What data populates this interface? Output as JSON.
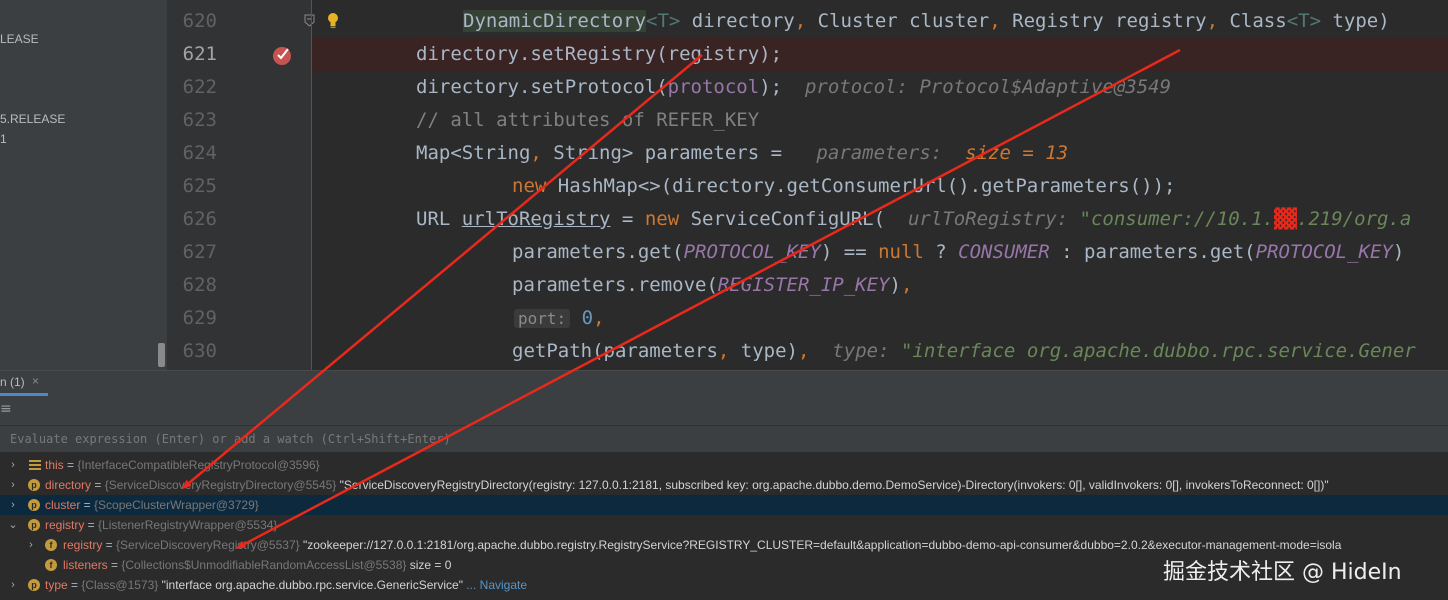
{
  "project_panel": {
    "items": [
      "LEASE",
      "5.RELEASE",
      "1"
    ]
  },
  "editor": {
    "line_numbers": [
      "620",
      "621",
      "622",
      "623",
      "624",
      "625",
      "626",
      "627",
      "628",
      "629",
      "630"
    ],
    "lines": {
      "l620": {
        "type": "DynamicDirectory",
        "generic": "<T>",
        "a": " directory",
        "c1": ",",
        "b": " Cluster cluster",
        "c2": ",",
        "d": " Registry registry",
        "c3": ",",
        "e": " Class",
        "f": "<T>",
        "g": " type)"
      },
      "l621": {
        "code": "directory.setRegistry(registry);"
      },
      "l622": {
        "code": "directory.setProtocol(",
        "p": "protocol",
        "end": ");",
        "hint": "protocol: Protocol$Adaptive@3549"
      },
      "l623": {
        "comment": "// all attributes of REFER_KEY"
      },
      "l624": {
        "a": "Map<String",
        "c": ",",
        "b": " String> parameters = ",
        "hint": "parameters: ",
        "hint_val": "size = 13"
      },
      "l625": {
        "kw": "new",
        "rest": " HashMap<>(directory.getConsumerUrl().getParameters());"
      },
      "l626": {
        "a": "URL ",
        "u": "urlToRegistry",
        "b": " = ",
        "kw": "new",
        "c": " ServiceConfigURL(",
        "hint": "urlToRegistry: ",
        "hint_str": "\"consumer://10.1.",
        "hint_str2": ".219/org.a"
      },
      "l627": {
        "a": "parameters.get(",
        "k1": "PROTOCOL_KEY",
        "b": ") == ",
        "kw": "null",
        "c": " ? ",
        "k2": "CONSUMER",
        "d": " : parameters.get(",
        "k3": "PROTOCOL_KEY",
        "e": ")"
      },
      "l628": {
        "a": "parameters.remove(",
        "k": "REGISTER_IP_KEY",
        "b": ")",
        "c": ","
      },
      "l629": {
        "param": "port:",
        "num": "0",
        "c": ","
      },
      "l630": {
        "a": "getPath(parameters",
        "c": ",",
        "b": " type)",
        "c2": ",",
        "hint": "type: ",
        "hint_str": "\"interface org.apache.dubbo.rpc.service.Gener"
      }
    }
  },
  "debug": {
    "tab_label": "n (1)",
    "tab_close": "×",
    "toolbar_icon": "≡",
    "eval_placeholder": "Evaluate expression (Enter) or add a watch (Ctrl+Shift+Enter)"
  },
  "variables": [
    {
      "name": "this",
      "type": "{InterfaceCompatibleRegistryProtocol@3596}",
      "value": "",
      "icon": "lines-icon",
      "expand": "collapsed"
    },
    {
      "name": "directory",
      "type": "{ServiceDiscoveryRegistryDirectory@5545}",
      "value": "\"ServiceDiscoveryRegistryDirectory(registry: 127.0.0.1:2181, subscribed key: org.apache.dubbo.demo.DemoService)-Directory(invokers: 0[], validInvokers: 0[], invokersToReconnect: 0[])\"",
      "icon": "p",
      "expand": "collapsed"
    },
    {
      "name": "cluster",
      "type": "{ScopeClusterWrapper@3729}",
      "value": "",
      "icon": "p",
      "expand": "collapsed"
    },
    {
      "name": "registry",
      "type": "{ListenerRegistryWrapper@5534}",
      "value": "",
      "icon": "p",
      "expand": "expanded"
    },
    {
      "name": "registry",
      "type": "{ServiceDiscoveryRegistry@5537}",
      "value": "\"zookeeper://127.0.0.1:2181/org.apache.dubbo.registry.RegistryService?REGISTRY_CLUSTER=default&application=dubbo-demo-api-consumer&dubbo=2.0.2&executor-management-mode=isola",
      "icon": "f",
      "expand": "collapsed"
    },
    {
      "name": "listeners",
      "type": "{Collections$UnmodifiableRandomAccessList@5538}",
      "value": " size = 0",
      "icon": "f",
      "expand": "none"
    },
    {
      "name": "type",
      "type": "{Class@1573}",
      "value": "\"interface org.apache.dubbo.rpc.service.GenericService\"",
      "nav": "... Navigate",
      "icon": "p",
      "expand": "collapsed"
    }
  ],
  "watermark": "掘金技术社区 @ HideIn",
  "colors": {
    "annotation_arrow": "#e8291c",
    "selection": "#0d293e",
    "breakpoint": "#c75450"
  }
}
